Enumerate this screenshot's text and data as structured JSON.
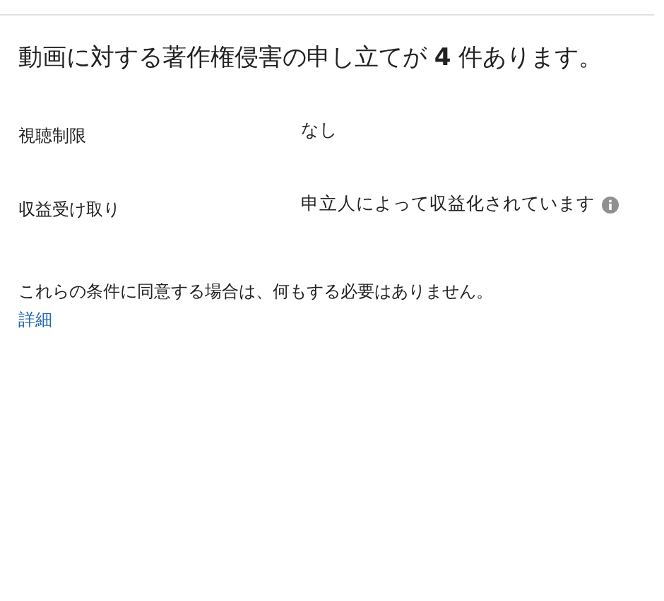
{
  "title": "動画に対する著作権侵害の申し立てが **4** 件あります。",
  "rows": [
    {
      "label": "視聴制限",
      "value": "なし",
      "info": false
    },
    {
      "label": "収益受け取り",
      "value": "申立人によって収益化されています",
      "info": true
    }
  ],
  "note": "これらの条件に同意する場合は、何もする必要はありません。",
  "link": "詳細"
}
